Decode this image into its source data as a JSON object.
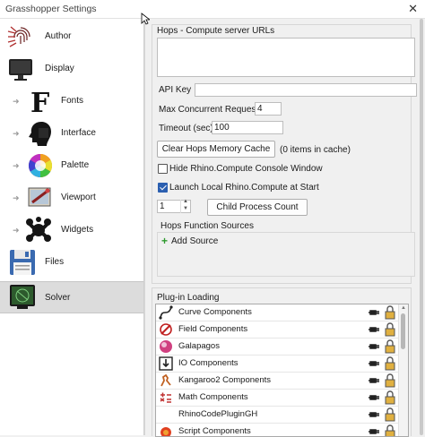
{
  "window": {
    "title": "Grasshopper Settings",
    "close_glyph": "✕"
  },
  "sidebar": {
    "items": [
      {
        "label": "Author",
        "icon": "fingerprint-icon"
      },
      {
        "label": "Display",
        "icon": "monitor-icon"
      },
      {
        "label": "Fonts",
        "icon": "font-f-icon"
      },
      {
        "label": "Interface",
        "icon": "head-silhouette-icon"
      },
      {
        "label": "Palette",
        "icon": "color-wheel-icon"
      },
      {
        "label": "Viewport",
        "icon": "viewport-icon"
      },
      {
        "label": "Widgets",
        "icon": "widgets-blob-icon"
      },
      {
        "label": "Files",
        "icon": "floppy-disk-icon"
      },
      {
        "label": "Solver",
        "icon": "solver-icon"
      }
    ],
    "selected": "Solver",
    "arrow_glyph": "➜"
  },
  "hops": {
    "urls_label": "Hops - Compute server URLs",
    "urls_value": "",
    "api_key_label": "API Key",
    "api_key_value": "",
    "max_requests_label": "Max Concurrent Requests",
    "max_requests_value": "4",
    "timeout_label": "Timeout (sec)",
    "timeout_value": "100",
    "clear_cache_label": "Clear Hops Memory Cache",
    "cache_status": "(0 items in cache)",
    "hide_console_label": "Hide Rhino.Compute Console Window",
    "hide_console_checked": false,
    "launch_local_label": "Launch Local Rhino.Compute at Start",
    "launch_local_checked": true,
    "child_count_value": "1",
    "child_count_button": "Child Process Count",
    "function_sources_label": "Hops Function Sources",
    "add_source_label": "Add Source"
  },
  "plugins": {
    "label": "Plug-in Loading",
    "items": [
      {
        "name": "Curve Components",
        "icon": "curve-icon"
      },
      {
        "name": "Field Components",
        "icon": "field-icon"
      },
      {
        "name": "Galapagos",
        "icon": "galapagos-icon"
      },
      {
        "name": "IO Components",
        "icon": "io-icon"
      },
      {
        "name": "Kangaroo2 Components",
        "icon": "kangaroo-icon"
      },
      {
        "name": "Math Components",
        "icon": "math-icon"
      },
      {
        "name": "RhinoCodePluginGH",
        "icon": ""
      },
      {
        "name": "Script Components",
        "icon": "script-icon"
      }
    ]
  },
  "colors": {
    "accent": "#2b5fb0",
    "add_green": "#2e9a2e"
  }
}
